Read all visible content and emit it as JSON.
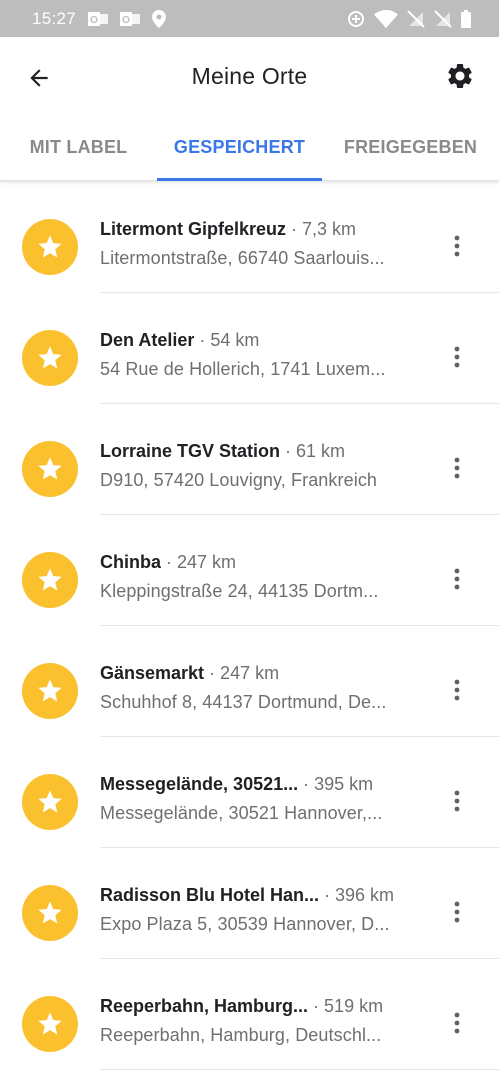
{
  "status_bar": {
    "time": "15:27",
    "left_icons": [
      "outlook-icon",
      "outlook-icon",
      "location-pin-icon"
    ],
    "right_icons": [
      "data-saver-icon",
      "wifi-icon",
      "no-sim-icon",
      "no-sim-icon",
      "battery-icon"
    ]
  },
  "app_bar": {
    "title": "Meine Orte",
    "back_icon": "arrow-back-icon",
    "settings_icon": "gear-icon"
  },
  "tabs": [
    {
      "label": "MIT LABEL",
      "active": false
    },
    {
      "label": "GESPEICHERT",
      "active": true
    },
    {
      "label": "FREIGEGEBEN",
      "active": false
    }
  ],
  "colors": {
    "accent": "#3b78e7",
    "star": "#fbc02d",
    "status_bar": "#bdbdbd"
  },
  "places": [
    {
      "name": "Litermont Gipfelkreuz",
      "distance": "· 7,3 km",
      "address": "Litermontstraße, 66740 Saarlouis..."
    },
    {
      "name": "Den Atelier",
      "distance": "· 54 km",
      "address": "54 Rue de Hollerich, 1741 Luxem..."
    },
    {
      "name": "Lorraine TGV Station",
      "distance": "· 61 km",
      "address": "D910, 57420 Louvigny, Frankreich"
    },
    {
      "name": "Chinba",
      "distance": "· 247 km",
      "address": "Kleppingstraße 24, 44135 Dortm..."
    },
    {
      "name": "Gänsemarkt",
      "distance": "· 247 km",
      "address": "Schuhhof 8, 44137 Dortmund, De..."
    },
    {
      "name": "Messegelände, 30521...",
      "distance": "· 395 km",
      "address": "Messegelände, 30521 Hannover,..."
    },
    {
      "name": "Radisson Blu Hotel Han...",
      "distance": "· 396 km",
      "address": "Expo Plaza 5, 30539 Hannover, D..."
    },
    {
      "name": "Reeperbahn, Hamburg...",
      "distance": "· 519 km",
      "address": "Reeperbahn, Hamburg, Deutschl..."
    }
  ]
}
